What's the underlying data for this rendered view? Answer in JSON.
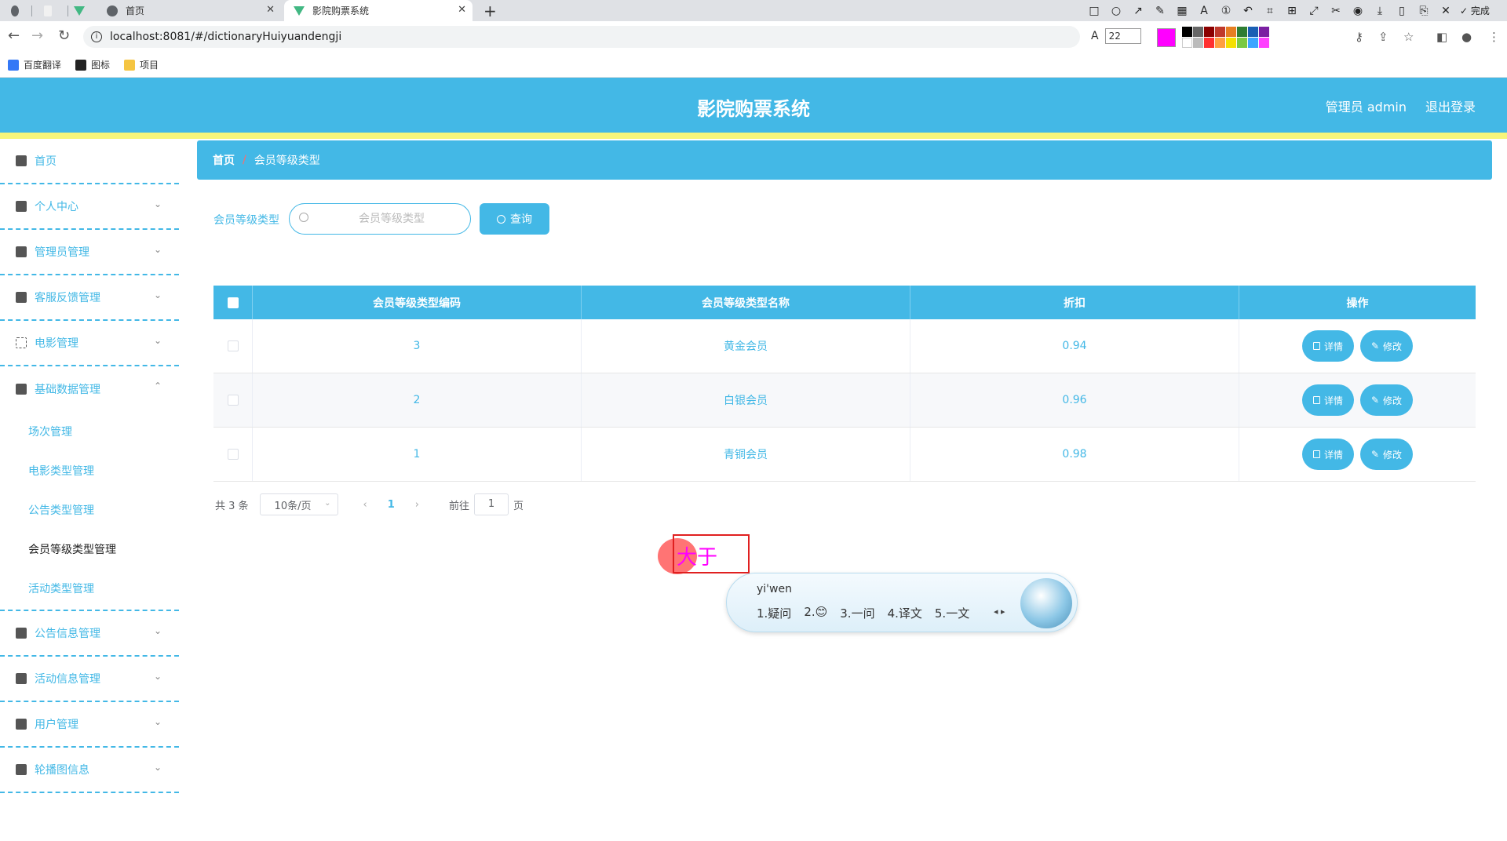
{
  "browser": {
    "tabs": [
      {
        "label": "首页",
        "active": false
      },
      {
        "label": "影院购票系统",
        "active": true
      }
    ],
    "url": "localhost:8081/#/dictionaryHuiyuandengji",
    "font_size": "22",
    "done_label": "完成",
    "bookmarks": [
      "百度翻译",
      "图标",
      "项目"
    ],
    "colors": {
      "current": "#ff00ff",
      "accent": "#43b8e6",
      "yellow": "#f7f57a"
    }
  },
  "header": {
    "title": "影院购票系统",
    "user": "管理员 admin",
    "logout": "退出登录"
  },
  "sidebar": {
    "items": [
      {
        "label": "首页",
        "icon": "home-icon"
      },
      {
        "label": "个人中心",
        "icon": "user-icon"
      },
      {
        "label": "管理员管理",
        "icon": "clipboard-icon"
      },
      {
        "label": "客服反馈管理",
        "icon": "grid-icon"
      },
      {
        "label": "电影管理",
        "icon": "fullscreen-icon"
      },
      {
        "label": "基础数据管理",
        "icon": "sliders-icon"
      },
      {
        "label": "公告信息管理",
        "icon": "user-icon"
      },
      {
        "label": "活动信息管理",
        "icon": "list-icon"
      },
      {
        "label": "用户管理",
        "icon": "briefcase-icon"
      },
      {
        "label": "轮播图信息",
        "icon": "camera-icon"
      }
    ],
    "submenu": [
      {
        "label": "场次管理",
        "active": false
      },
      {
        "label": "电影类型管理",
        "active": false
      },
      {
        "label": "公告类型管理",
        "active": false
      },
      {
        "label": "会员等级类型管理",
        "active": true
      },
      {
        "label": "活动类型管理",
        "active": false
      }
    ]
  },
  "breadcrumb": {
    "home": "首页",
    "separator": "/",
    "current": "会员等级类型"
  },
  "search": {
    "label": "会员等级类型",
    "placeholder": "会员等级类型",
    "button": "查询"
  },
  "table": {
    "columns": [
      "会员等级类型编码",
      "会员等级类型名称",
      "折扣",
      "操作"
    ],
    "rows": [
      {
        "code": "3",
        "name": "黄金会员",
        "discount": "0.94"
      },
      {
        "code": "2",
        "name": "白银会员",
        "discount": "0.96"
      },
      {
        "code": "1",
        "name": "青铜会员",
        "discount": "0.98"
      }
    ],
    "detail_label": "详情",
    "edit_label": "修改"
  },
  "pagination": {
    "total": "共 3 条",
    "page_size": "10条/页",
    "prev": "‹",
    "next": "›",
    "current": "1",
    "goto": "前往",
    "goto_value": "1",
    "page_suffix": "页"
  },
  "overlay": {
    "annotation_text": "大于",
    "ime_pinyin": "yi'wen",
    "ime_candidates": [
      "1.疑问",
      "2.😊",
      "3.一问",
      "4.译文",
      "5.一文"
    ]
  }
}
